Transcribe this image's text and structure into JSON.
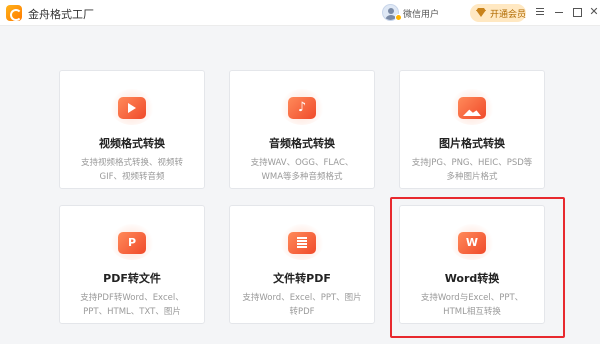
{
  "app": {
    "title": "金舟格式工厂"
  },
  "header": {
    "user_name": "微信用户",
    "vip_label": "开通会员"
  },
  "cards": [
    {
      "title": "视频格式转换",
      "desc": "支持视频格式转换、视频转GIF、视频转音频",
      "icon": "video-icon"
    },
    {
      "title": "音频格式转换",
      "desc": "支持WAV、OGG、FLAC、WMA等多种音频格式",
      "icon": "audio-icon"
    },
    {
      "title": "图片格式转换",
      "desc": "支持JPG、PNG、HEIC、PSD等多种图片格式",
      "icon": "image-icon"
    },
    {
      "title": "PDF转文件",
      "desc": "支持PDF转Word、Excel、PPT、HTML、TXT、图片",
      "icon": "pdf-icon",
      "glyph": "P"
    },
    {
      "title": "文件转PDF",
      "desc": "支持Word、Excel、PPT、图片转PDF",
      "icon": "file-icon"
    },
    {
      "title": "Word转换",
      "desc": "支持Word与Excel、PPT、HTML相互转换",
      "icon": "word-icon",
      "glyph": "W"
    }
  ],
  "colors": {
    "accent": "#f04a2a",
    "highlight": "#e8292e",
    "vip_bg": "#ffe8c2"
  }
}
